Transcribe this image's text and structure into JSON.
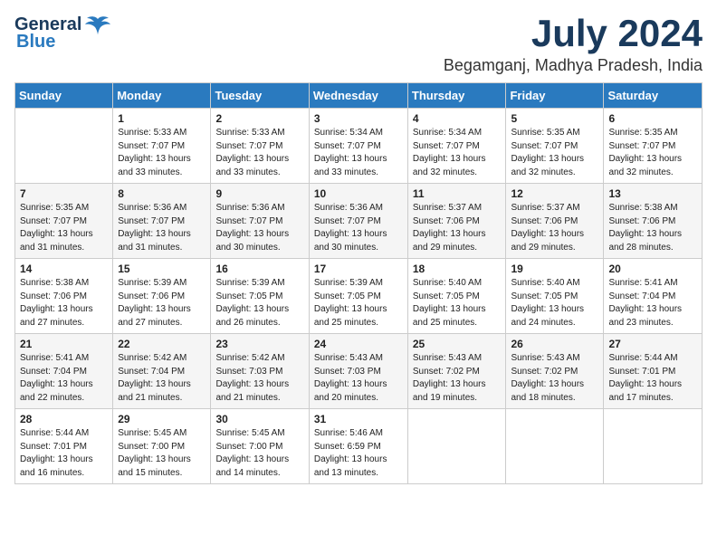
{
  "logo": {
    "general": "General",
    "blue": "Blue"
  },
  "title": "July 2024",
  "location": "Begamganj, Madhya Pradesh, India",
  "days_of_week": [
    "Sunday",
    "Monday",
    "Tuesday",
    "Wednesday",
    "Thursday",
    "Friday",
    "Saturday"
  ],
  "weeks": [
    [
      {
        "day": "",
        "info": ""
      },
      {
        "day": "1",
        "info": "Sunrise: 5:33 AM\nSunset: 7:07 PM\nDaylight: 13 hours\nand 33 minutes."
      },
      {
        "day": "2",
        "info": "Sunrise: 5:33 AM\nSunset: 7:07 PM\nDaylight: 13 hours\nand 33 minutes."
      },
      {
        "day": "3",
        "info": "Sunrise: 5:34 AM\nSunset: 7:07 PM\nDaylight: 13 hours\nand 33 minutes."
      },
      {
        "day": "4",
        "info": "Sunrise: 5:34 AM\nSunset: 7:07 PM\nDaylight: 13 hours\nand 32 minutes."
      },
      {
        "day": "5",
        "info": "Sunrise: 5:35 AM\nSunset: 7:07 PM\nDaylight: 13 hours\nand 32 minutes."
      },
      {
        "day": "6",
        "info": "Sunrise: 5:35 AM\nSunset: 7:07 PM\nDaylight: 13 hours\nand 32 minutes."
      }
    ],
    [
      {
        "day": "7",
        "info": "Sunrise: 5:35 AM\nSunset: 7:07 PM\nDaylight: 13 hours\nand 31 minutes."
      },
      {
        "day": "8",
        "info": "Sunrise: 5:36 AM\nSunset: 7:07 PM\nDaylight: 13 hours\nand 31 minutes."
      },
      {
        "day": "9",
        "info": "Sunrise: 5:36 AM\nSunset: 7:07 PM\nDaylight: 13 hours\nand 30 minutes."
      },
      {
        "day": "10",
        "info": "Sunrise: 5:36 AM\nSunset: 7:07 PM\nDaylight: 13 hours\nand 30 minutes."
      },
      {
        "day": "11",
        "info": "Sunrise: 5:37 AM\nSunset: 7:06 PM\nDaylight: 13 hours\nand 29 minutes."
      },
      {
        "day": "12",
        "info": "Sunrise: 5:37 AM\nSunset: 7:06 PM\nDaylight: 13 hours\nand 29 minutes."
      },
      {
        "day": "13",
        "info": "Sunrise: 5:38 AM\nSunset: 7:06 PM\nDaylight: 13 hours\nand 28 minutes."
      }
    ],
    [
      {
        "day": "14",
        "info": "Sunrise: 5:38 AM\nSunset: 7:06 PM\nDaylight: 13 hours\nand 27 minutes."
      },
      {
        "day": "15",
        "info": "Sunrise: 5:39 AM\nSunset: 7:06 PM\nDaylight: 13 hours\nand 27 minutes."
      },
      {
        "day": "16",
        "info": "Sunrise: 5:39 AM\nSunset: 7:05 PM\nDaylight: 13 hours\nand 26 minutes."
      },
      {
        "day": "17",
        "info": "Sunrise: 5:39 AM\nSunset: 7:05 PM\nDaylight: 13 hours\nand 25 minutes."
      },
      {
        "day": "18",
        "info": "Sunrise: 5:40 AM\nSunset: 7:05 PM\nDaylight: 13 hours\nand 25 minutes."
      },
      {
        "day": "19",
        "info": "Sunrise: 5:40 AM\nSunset: 7:05 PM\nDaylight: 13 hours\nand 24 minutes."
      },
      {
        "day": "20",
        "info": "Sunrise: 5:41 AM\nSunset: 7:04 PM\nDaylight: 13 hours\nand 23 minutes."
      }
    ],
    [
      {
        "day": "21",
        "info": "Sunrise: 5:41 AM\nSunset: 7:04 PM\nDaylight: 13 hours\nand 22 minutes."
      },
      {
        "day": "22",
        "info": "Sunrise: 5:42 AM\nSunset: 7:04 PM\nDaylight: 13 hours\nand 21 minutes."
      },
      {
        "day": "23",
        "info": "Sunrise: 5:42 AM\nSunset: 7:03 PM\nDaylight: 13 hours\nand 21 minutes."
      },
      {
        "day": "24",
        "info": "Sunrise: 5:43 AM\nSunset: 7:03 PM\nDaylight: 13 hours\nand 20 minutes."
      },
      {
        "day": "25",
        "info": "Sunrise: 5:43 AM\nSunset: 7:02 PM\nDaylight: 13 hours\nand 19 minutes."
      },
      {
        "day": "26",
        "info": "Sunrise: 5:43 AM\nSunset: 7:02 PM\nDaylight: 13 hours\nand 18 minutes."
      },
      {
        "day": "27",
        "info": "Sunrise: 5:44 AM\nSunset: 7:01 PM\nDaylight: 13 hours\nand 17 minutes."
      }
    ],
    [
      {
        "day": "28",
        "info": "Sunrise: 5:44 AM\nSunset: 7:01 PM\nDaylight: 13 hours\nand 16 minutes."
      },
      {
        "day": "29",
        "info": "Sunrise: 5:45 AM\nSunset: 7:00 PM\nDaylight: 13 hours\nand 15 minutes."
      },
      {
        "day": "30",
        "info": "Sunrise: 5:45 AM\nSunset: 7:00 PM\nDaylight: 13 hours\nand 14 minutes."
      },
      {
        "day": "31",
        "info": "Sunrise: 5:46 AM\nSunset: 6:59 PM\nDaylight: 13 hours\nand 13 minutes."
      },
      {
        "day": "",
        "info": ""
      },
      {
        "day": "",
        "info": ""
      },
      {
        "day": "",
        "info": ""
      }
    ]
  ]
}
